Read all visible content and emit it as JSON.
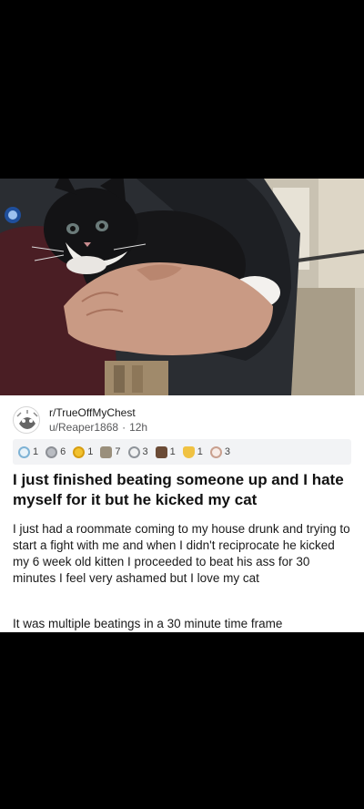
{
  "post": {
    "subreddit": "r/TrueOffMyChest",
    "username": "u/Reaper1868",
    "time": "12h",
    "awards": [
      {
        "icon": "helpful-award-icon",
        "count": "1",
        "color": "#7fb3d5"
      },
      {
        "icon": "silver-award-icon",
        "count": "6",
        "color": "#b9bcc2"
      },
      {
        "icon": "gold-award-icon",
        "count": "1",
        "color": "#f2c230"
      },
      {
        "icon": "wholesome-award-icon",
        "count": "7",
        "color": "#9a8f7c"
      },
      {
        "icon": "hugz-award-icon",
        "count": "3",
        "color": "#b7bbc0"
      },
      {
        "icon": "bear-award-icon",
        "count": "1",
        "color": "#6b4b36"
      },
      {
        "icon": "rocket-award-icon",
        "count": "1",
        "color": "#f0c243"
      },
      {
        "icon": "heart-award-icon",
        "count": "3",
        "color": "#c9a08f"
      }
    ],
    "title": "I just finished beating someone up and I hate myself for it but he kicked my cat",
    "body_paragraph_1": "I just had a roommate coming to my house drunk and trying to start a fight with me and when I didn't reciprocate he kicked my 6 week old kitten I proceeded to beat his ass for 30 minutes I feel very ashamed but I love my cat",
    "body_paragraph_2": "It was multiple beatings in a 30 minute time frame"
  }
}
